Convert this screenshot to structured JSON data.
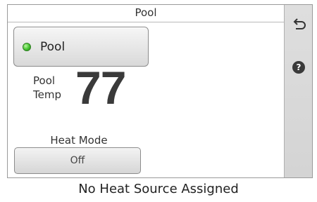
{
  "header": {
    "title": "Pool"
  },
  "pool_button": {
    "label": "Pool",
    "status_color": "#43c22e"
  },
  "temperature": {
    "label_line1": "Pool",
    "label_line2": "Temp",
    "value": "77"
  },
  "heat_mode": {
    "label": "Heat Mode",
    "value": "Off"
  },
  "sidebar": {
    "back_icon": "back-arrow-icon",
    "help_icon": "help-icon",
    "help_glyph": "?"
  },
  "footer": {
    "message": "No Heat Source Assigned"
  }
}
